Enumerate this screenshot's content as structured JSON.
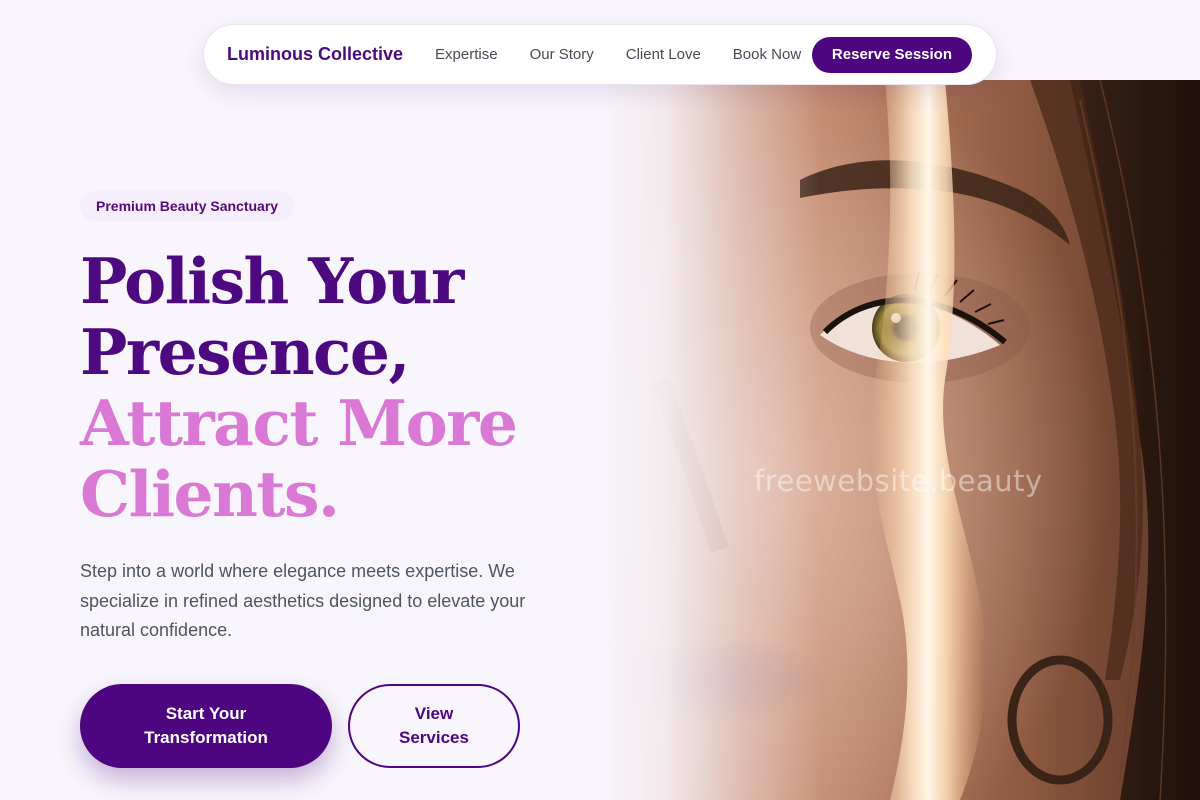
{
  "nav": {
    "brand": "Luminous Collective",
    "links": [
      "Expertise",
      "Our Story",
      "Client Love",
      "Book Now"
    ],
    "cta": "Reserve Session"
  },
  "hero": {
    "badge": "Premium Beauty Sanctuary",
    "headline_lines": [
      "Polish Your",
      "Presence,",
      "Attract More",
      "Clients."
    ],
    "description": "Step into a world where elegance meets expertise. We specialize in refined aesthetics designed to elevate your natural confidence.",
    "primary_cta": "Start Your Transformation",
    "secondary_cta": "View Services"
  },
  "image": {
    "watermark": "freewebsite.beauty",
    "subject": "close-up-face-with-light-streak"
  },
  "colors": {
    "brand_purple": "#4d067f",
    "accent_pink": "#d978d5",
    "background": "#f8f5fc",
    "body_text": "#4d5563"
  }
}
